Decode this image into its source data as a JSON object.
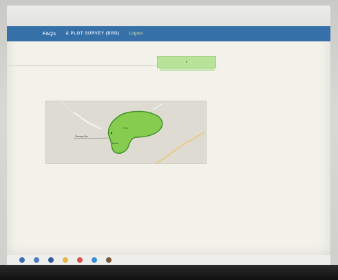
{
  "nav": {
    "items": [
      "FAQs",
      "& PLOT SURVEY (BRD)",
      "Logout"
    ]
  },
  "map": {
    "labels": [
      "Plot",
      "Survey No.",
      "Area"
    ]
  },
  "colors": {
    "nav_bar": "#3570a8",
    "plot_fill": "#86cc4e",
    "plot_stroke": "#3f8b2a",
    "highlight_box": "#b9e39a"
  },
  "taskbar": {
    "icons": [
      "windows-icon",
      "search-icon",
      "task-view-icon",
      "file-explorer-icon",
      "chrome-icon",
      "edge-icon",
      "app-icon"
    ]
  }
}
